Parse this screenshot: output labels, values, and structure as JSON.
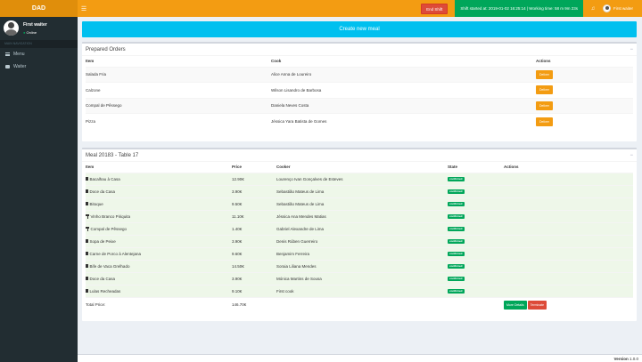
{
  "app": {
    "logo": "DAD"
  },
  "header": {
    "end_shift_label": "End Shift",
    "shift_info": "Shift started at: 2019-01-02 16:25:14 | Working time: 58 m 9m 23s",
    "user_name": "First waiter"
  },
  "sidebar": {
    "user_name": "First waiter",
    "status": "Online",
    "nav_header": "MAIN NAVIGATION",
    "items": [
      {
        "label": "Menu"
      },
      {
        "label": "Waiter"
      }
    ]
  },
  "main": {
    "create_button": "Create new meal",
    "prepared": {
      "title": "Prepared Orders",
      "columns": [
        "Item",
        "Cook",
        "Actions"
      ],
      "rows": [
        {
          "item": "Salada Fria",
          "cook": "Alice Anna de Loureiro",
          "action": "Deliver"
        },
        {
          "item": "Calzone",
          "cook": "Wilson Lisandro de Barbosa",
          "action": "Deliver"
        },
        {
          "item": "Compal de Pêssego",
          "cook": "Daniela Neves Costa",
          "action": "Deliver"
        },
        {
          "item": "Pizza",
          "cook": "Jéssica Yara Batista de Gomes",
          "action": "Deliver"
        }
      ]
    },
    "meal": {
      "title": "Meal 20183 - Table 17",
      "columns": [
        "Item",
        "Price",
        "Cooker",
        "State",
        "Actions"
      ],
      "rows": [
        {
          "type": "food",
          "item": "Bacalhau à Casa",
          "price": "12.90€",
          "cooker": "Lourenço Ivan Gonçalves de Esteves",
          "state": "confirmed"
        },
        {
          "type": "food",
          "item": "Doce da Casa",
          "price": "3.90€",
          "cooker": "Sebastião Mateus de Lima",
          "state": "confirmed"
        },
        {
          "type": "food",
          "item": "Bitoque",
          "price": "9.50€",
          "cooker": "Sebastião Mateus de Lima",
          "state": "confirmed"
        },
        {
          "type": "drink",
          "item": "Vinho Branco Piriquita",
          "price": "11.10€",
          "cooker": "Jéssica Ana Mendes Matias",
          "state": "confirmed"
        },
        {
          "type": "drink",
          "item": "Compal de Pêssego",
          "price": "1.40€",
          "cooker": "Gabriel Alexandre de Lima",
          "state": "confirmed"
        },
        {
          "type": "food",
          "item": "Sopa de Peixe",
          "price": "3.90€",
          "cooker": "Denis Rúben Guerreiro",
          "state": "confirmed"
        },
        {
          "type": "food",
          "item": "Carne de Porco à Alentejana",
          "price": "9.60€",
          "cooker": "Benjamim Ferreira",
          "state": "confirmed"
        },
        {
          "type": "food",
          "item": "Bife de Vaca Grelhado",
          "price": "14.50€",
          "cooker": "Soraia Liliana Mendes",
          "state": "confirmed"
        },
        {
          "type": "food",
          "item": "Doce da Casa",
          "price": "3.90€",
          "cooker": "Mónica Martins de Sousa",
          "state": "confirmed"
        },
        {
          "type": "food",
          "item": "Lulas Recheadas",
          "price": "9.10€",
          "cooker": "First cook",
          "state": "confirmed"
        }
      ],
      "total_label": "Total Price:",
      "total_value": "146.70€",
      "more_details_label": "More Details",
      "terminate_label": "Terminate"
    }
  },
  "footer": {
    "version_label": "Version",
    "version_value": "1.0.0"
  },
  "colors": {
    "accent": "#f39c12",
    "sidebar": "#222d32",
    "create": "#00c0ef",
    "success": "#00a65a",
    "danger": "#dd4b39"
  }
}
